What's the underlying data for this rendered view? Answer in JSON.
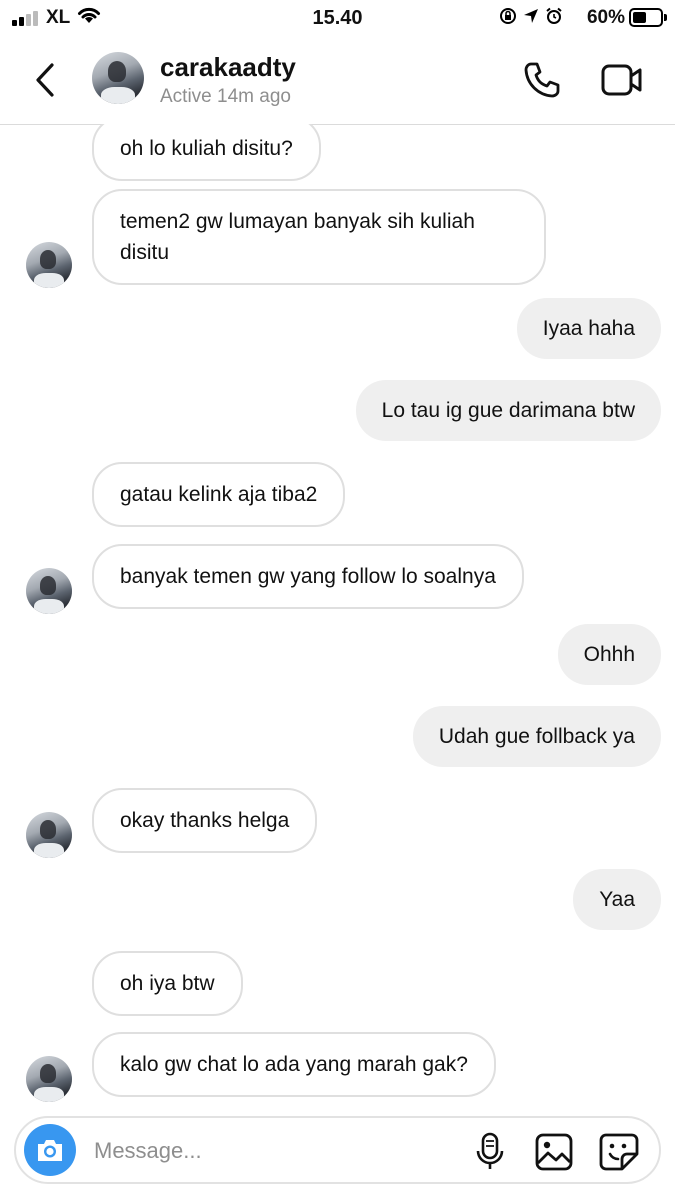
{
  "status_bar": {
    "carrier": "XL",
    "time": "15.40",
    "battery_percent": "60%",
    "battery_level": 0.6,
    "icons": [
      "signal-icon",
      "wifi-icon",
      "orientation-lock-icon",
      "location-icon",
      "alarm-icon",
      "battery-icon"
    ]
  },
  "header": {
    "username": "carakaadty",
    "status": "Active 14m ago",
    "icons": [
      "back-icon",
      "phone-icon",
      "video-call-icon"
    ]
  },
  "messages": [
    {
      "side": "in",
      "text": "oh lo kuliah disitu?"
    },
    {
      "side": "in",
      "text": "temen2 gw lumayan banyak sih kuliah disitu"
    },
    {
      "side": "out",
      "text": "Iyaa haha"
    },
    {
      "side": "out",
      "text": "Lo tau ig gue darimana btw"
    },
    {
      "side": "in",
      "text": "gatau kelink aja tiba2"
    },
    {
      "side": "in",
      "text": "banyak temen gw yang follow lo soalnya"
    },
    {
      "side": "out",
      "text": "Ohhh"
    },
    {
      "side": "out",
      "text": "Udah gue follback ya"
    },
    {
      "side": "in",
      "text": "okay thanks helga"
    },
    {
      "side": "out",
      "text": "Yaa"
    },
    {
      "side": "in",
      "text": "oh iya btw"
    },
    {
      "side": "in",
      "text": "kalo gw chat lo ada yang marah gak?"
    }
  ],
  "composer": {
    "placeholder": "Message...",
    "value": "",
    "icons": [
      "camera-icon",
      "microphone-icon",
      "gallery-icon",
      "sticker-icon"
    ]
  },
  "colors": {
    "camera_button": "#3897f0",
    "outgoing_bubble": "#efefef",
    "incoming_border": "#dfdfdf",
    "secondary_text": "#8e8e8e"
  }
}
